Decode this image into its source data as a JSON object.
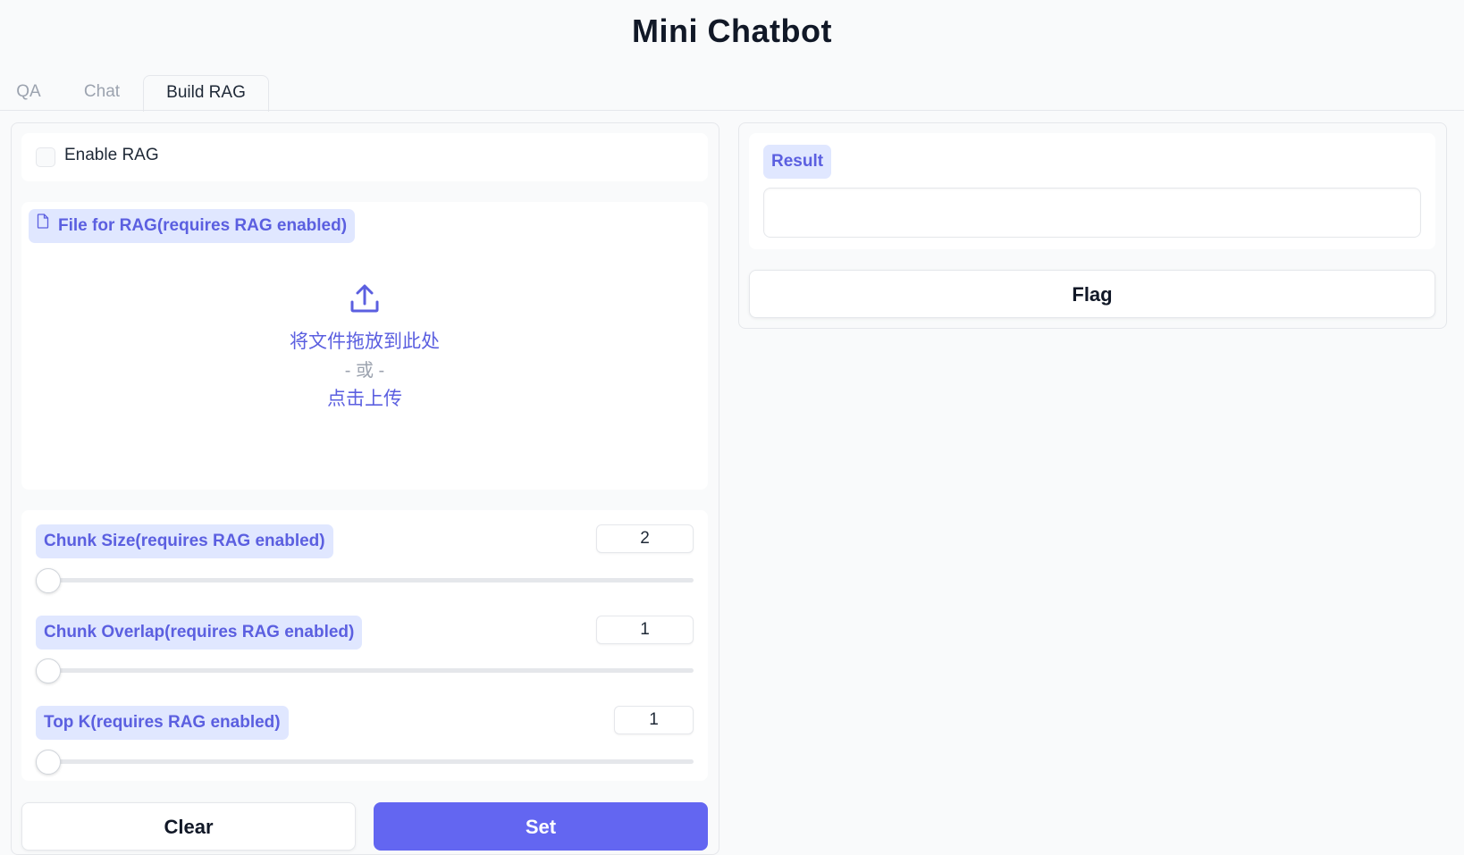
{
  "app": {
    "title": "Mini Chatbot"
  },
  "tabs": [
    {
      "label": "QA",
      "active": false
    },
    {
      "label": "Chat",
      "active": false
    },
    {
      "label": "Build RAG",
      "active": true
    }
  ],
  "rag": {
    "enable_label": "Enable RAG",
    "enabled": false,
    "file_label": "File for RAG(requires RAG enabled)",
    "file_icon": "file-icon",
    "upload": {
      "icon": "upload-icon",
      "drop_text": "将文件拖放到此处",
      "or_text": "- 或 -",
      "click_text": "点击上传"
    }
  },
  "sliders": [
    {
      "label": "Chunk Size(requires RAG enabled)",
      "value": "2"
    },
    {
      "label": "Chunk Overlap(requires RAG enabled)",
      "value": "1"
    },
    {
      "label": "Top K(requires RAG enabled)",
      "value": "1"
    }
  ],
  "actions": {
    "clear_label": "Clear",
    "set_label": "Set"
  },
  "result": {
    "label": "Result",
    "value": ""
  },
  "flag": {
    "label": "Flag"
  },
  "colors": {
    "accent": "#6366f1",
    "badge_bg": "#e0e7ff",
    "badge_text": "#5b5fe0",
    "background": "#f9fafb"
  }
}
